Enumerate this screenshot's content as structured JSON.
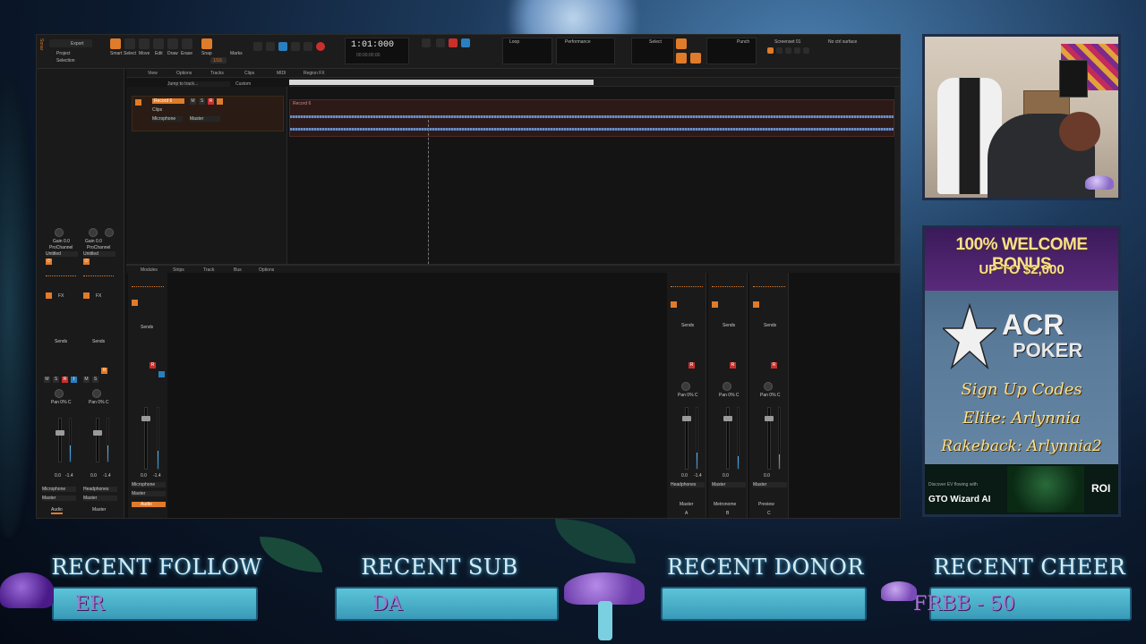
{
  "colors": {
    "accent": "#e07b2a",
    "record": "#c9302c",
    "meter": "#2a7fbf",
    "stat_title": "#d6ecf4",
    "stat_value": "#a27ad0",
    "gold": "#f8e08a"
  },
  "daw": {
    "app_name": "Sonar",
    "export_label": "Export",
    "project_label": "Project",
    "selection_label": "Selection",
    "tools": [
      "Smart",
      "Select",
      "Move",
      "Edit",
      "Draw",
      "Erase"
    ],
    "snap_label": "Snap",
    "snap_value": "1/16",
    "marks_label": "Marks",
    "time": "1:01:000",
    "time_sub": "00:00:00:00",
    "loop_label": "Loop",
    "performance_label": "Performance",
    "select_label": "Select",
    "punch_label": "Punch",
    "screenset_label": "Screenset 01",
    "no_ctrl_surface": "No ctrl surface",
    "screenset_numbers": [
      "1",
      "2",
      "3",
      "4",
      "5",
      "6",
      "7",
      "8",
      "9",
      "10"
    ],
    "track_menu": [
      "View",
      "Options",
      "Tracks",
      "Clips",
      "MIDI",
      "Region FX"
    ],
    "jump_to_track": "Jump to track...",
    "custom_label": "Custom",
    "track_name": "Record 6",
    "clip_name": "Record 6",
    "track_output": "Master",
    "track_input": "Microphone",
    "track_clips_label": "Clips",
    "console_menu": [
      "Modules",
      "Strips",
      "Track",
      "Bus",
      "Options"
    ],
    "inspector": {
      "strips": [
        {
          "gain_label": "Gain 0.0",
          "channel_label": "ProChannel",
          "preset": "Untitled",
          "sends": "Sends",
          "pan": "Pan 0% C",
          "vol": "0.0",
          "peak": "-1.4",
          "input": "Microphone",
          "output": "Master",
          "name": "Audio"
        },
        {
          "gain_label": "Gain 0.0",
          "channel_label": "ProChannel",
          "preset": "Untitled",
          "sends": "Sends",
          "pan": "Pan 0% C",
          "vol": "0.0",
          "peak": "-1.4",
          "input": "Headphones",
          "output": "Master",
          "name": "Master"
        }
      ]
    },
    "console_strips": [
      {
        "name": "Master",
        "letter": "A",
        "sends": "Sends",
        "pan": "Pan 0% C",
        "vol": "0.0",
        "peak": "-1.4",
        "output": "Headphones",
        "out2": "Master"
      },
      {
        "name": "Metronome",
        "letter": "B",
        "sends": "Sends",
        "pan": "Pan 0% C",
        "vol": "0.0",
        "peak": "",
        "output": "Master",
        "out2": "Master"
      },
      {
        "name": "Preview",
        "letter": "C",
        "sends": "Sends",
        "pan": "Pan 0% C",
        "vol": "0.0",
        "peak": "",
        "output": "Master",
        "out2": "Master"
      }
    ],
    "console_left": {
      "sends": "Sends",
      "vol": "0.0",
      "peak": "-1.4",
      "input": "Microphone",
      "output": "Master",
      "name": "Audio"
    }
  },
  "ad": {
    "bonus_title": "100% WELCOME BONUS",
    "bonus_sub": "UP TO $2,000",
    "brand_name": "ACR",
    "brand_sub": "POKER",
    "codes_title": "Sign Up Codes",
    "elite_code": "Elite: Arlynnia",
    "rakeback_code": "Rakeback: Arlynnia2",
    "gto_small": "Discover EV flowing with",
    "gto_title": "GTO Wizard AI",
    "roi_label": "ROI"
  },
  "stats": [
    {
      "title": "RECENT FOLLOW",
      "value": "ER"
    },
    {
      "title": "RECENT SUB",
      "value": "DA"
    },
    {
      "title": "RECENT DONOR",
      "value": ""
    },
    {
      "title": "RECENT CHEER",
      "value": "FRBB - 50"
    }
  ]
}
